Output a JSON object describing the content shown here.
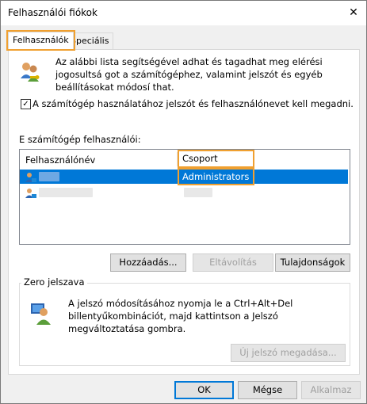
{
  "window": {
    "title": "Felhasználói fiókok",
    "close_glyph": "✕"
  },
  "tabs": [
    {
      "label": "Felhasználók"
    },
    {
      "label": "Speciális"
    }
  ],
  "intro": {
    "text": "Az alábbi lista segítségével adhat és tagadhat meg elérési jogosultsá got a számítógéphez, valamint jelszót és egyéb beállításokat módosí that."
  },
  "checkbox": {
    "label": "A számítógép használatához jelszót és felhasználónevet kell megadni.",
    "checked": true,
    "mark": "✓"
  },
  "users_section": {
    "label": "E számítógép felhasználói:"
  },
  "table": {
    "columns": [
      "Felhasználónév",
      "Csoport"
    ],
    "rows": [
      {
        "username": "",
        "group": "Administrators",
        "selected": true
      },
      {
        "username": "",
        "group": "",
        "selected": false
      }
    ]
  },
  "buttons": {
    "add": "Hozzáadás...",
    "remove": "Eltávolítás",
    "properties": "Tulajdonságok"
  },
  "password_group": {
    "title": "Zero jelszava",
    "text": "A jelszó módosításához nyomja le a Ctrl+Alt+Del billentyűkombinációt, majd kattintson a Jelszó megváltoztatása gombra.",
    "new_password_button": "Új jelszó megadása..."
  },
  "footer": {
    "ok": "OK",
    "cancel": "Mégse",
    "apply": "Alkalmaz"
  },
  "colors": {
    "accent": "#0078d7",
    "highlight": "#f0a030"
  }
}
